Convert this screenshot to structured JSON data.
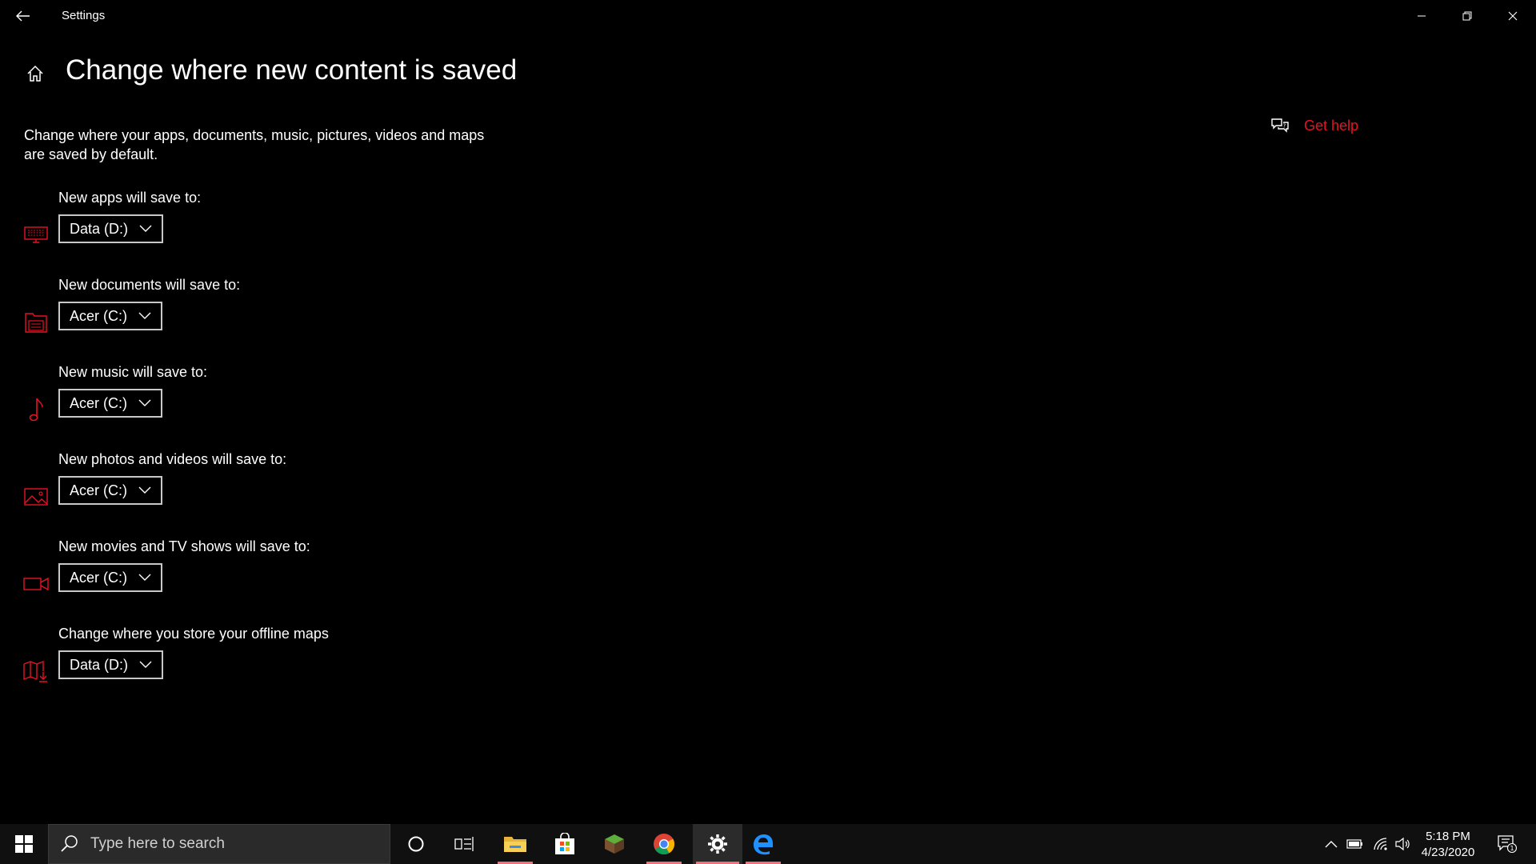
{
  "window": {
    "title": "Settings"
  },
  "page": {
    "title": "Change where new content is saved",
    "description": "Change where your apps, documents, music, pictures, videos and maps are saved by default.",
    "get_help": "Get help"
  },
  "settings": [
    {
      "label": "New apps will save to:",
      "value": "Data (D:)",
      "icon": "monitor-icon"
    },
    {
      "label": "New documents will save to:",
      "value": "Acer (C:)",
      "icon": "documents-icon"
    },
    {
      "label": "New music will save to:",
      "value": "Acer (C:)",
      "icon": "music-note-icon"
    },
    {
      "label": "New photos and videos will save to:",
      "value": "Acer (C:)",
      "icon": "picture-icon"
    },
    {
      "label": "New movies and TV shows will save to:",
      "value": "Acer (C:)",
      "icon": "video-camera-icon"
    },
    {
      "label": "Change where you store your offline maps",
      "value": "Data (D:)",
      "icon": "offline-map-icon"
    }
  ],
  "taskbar": {
    "search_placeholder": "Type here to search",
    "time": "5:18 PM",
    "date": "4/23/2020",
    "notification_count": "1"
  },
  "colors": {
    "accent": "#e81123",
    "background": "#000000",
    "taskbar": "#101010"
  }
}
